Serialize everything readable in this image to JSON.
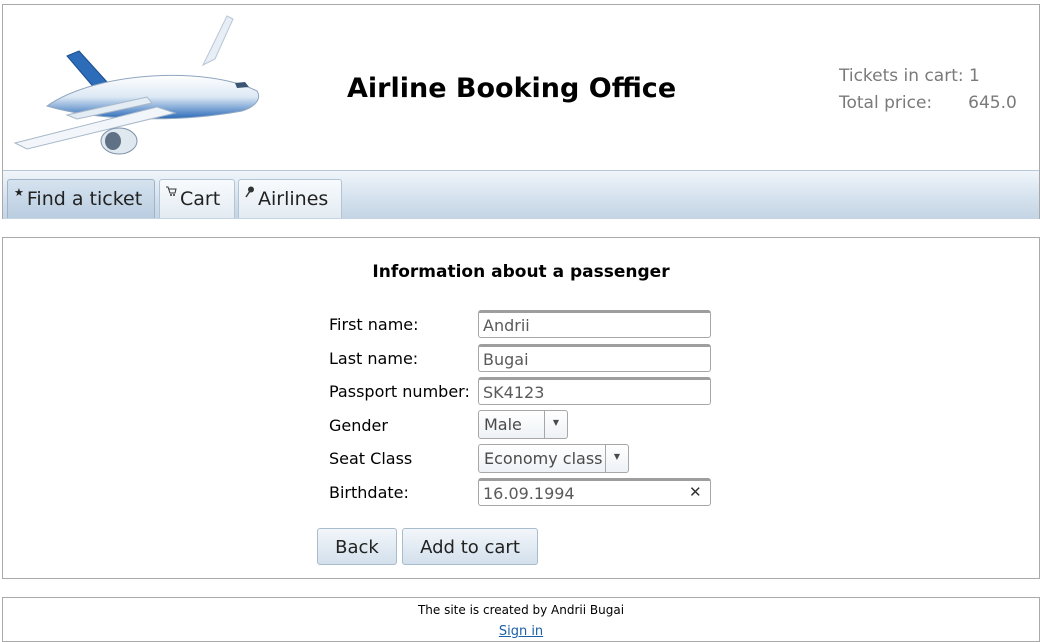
{
  "header": {
    "title": "Airline Booking Office",
    "cart": {
      "tickets_label": "Tickets in cart:",
      "tickets_count": "1",
      "price_label": "Total price:",
      "price_value": "645.0"
    }
  },
  "tabs": [
    {
      "label": "Find a ticket",
      "icon": "star-icon",
      "glyph": "★",
      "active": true
    },
    {
      "label": "Cart",
      "icon": "cart-icon",
      "glyph": "🛒",
      "active": false
    },
    {
      "label": "Airlines",
      "icon": "pin-icon",
      "glyph": "✎",
      "active": false
    }
  ],
  "form": {
    "title": "Information about a passenger",
    "first_name": {
      "label": "First name:",
      "value": "Andrii"
    },
    "last_name": {
      "label": "Last name:",
      "value": "Bugai"
    },
    "passport": {
      "label": "Passport number:",
      "value": "SK4123"
    },
    "gender": {
      "label": "Gender",
      "value": "Male"
    },
    "seat_class": {
      "label": "Seat Class",
      "value": "Economy class"
    },
    "birthdate": {
      "label": "Birthdate:",
      "value": "16.09.1994"
    },
    "back_label": "Back",
    "add_label": "Add to cart"
  },
  "footer": {
    "credit": "The site is created by Andrii Bugai",
    "signin": "Sign in"
  },
  "colors": {
    "accent": "#1a5fa8",
    "tab_bar": "#d5e2ee"
  }
}
